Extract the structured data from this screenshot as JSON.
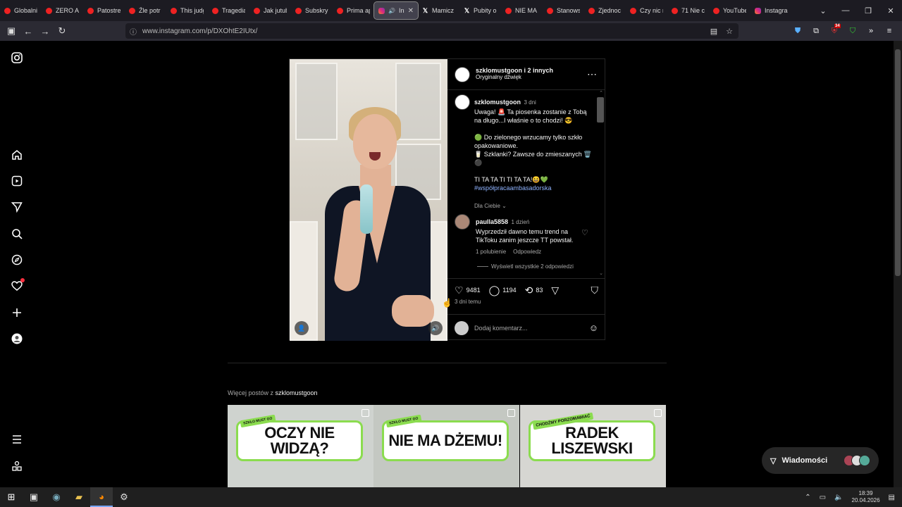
{
  "browser": {
    "tabs": [
      {
        "label": "Globalni",
        "icon": "youtube-icon"
      },
      {
        "label": "ZERO A",
        "icon": "youtube-icon"
      },
      {
        "label": "Patostre",
        "icon": "youtube-icon"
      },
      {
        "label": "Źle potr",
        "icon": "youtube-icon"
      },
      {
        "label": "This judg",
        "icon": "youtube-icon"
      },
      {
        "label": "Tragedia",
        "icon": "youtube-icon"
      },
      {
        "label": "Jak jutub",
        "icon": "youtube-icon"
      },
      {
        "label": "Subskryp",
        "icon": "youtube-icon"
      },
      {
        "label": "Prima ap",
        "icon": "youtube-icon"
      },
      {
        "label": "Inst",
        "icon": "instagram-icon",
        "active": true
      },
      {
        "label": "Mamicz",
        "icon": "x-icon"
      },
      {
        "label": "Pubity o",
        "icon": "x-icon"
      },
      {
        "label": "NIE MA",
        "icon": "youtube-icon"
      },
      {
        "label": "Stanows",
        "icon": "youtube-icon"
      },
      {
        "label": "Zjednoc",
        "icon": "youtube-icon"
      },
      {
        "label": "Czy nic n",
        "icon": "youtube-icon"
      },
      {
        "label": "71 Nie c",
        "icon": "youtube-icon"
      },
      {
        "label": "YouTube",
        "icon": "youtube-icon"
      },
      {
        "label": "Instagra",
        "icon": "instagram-icon"
      }
    ],
    "url": "www.instagram.com/p/DXOhtE2IUtx/",
    "extension_badge": "34"
  },
  "post": {
    "header": {
      "author": "szklomustgoon i 2 innych",
      "subtitle": "Oryginalny dźwięk"
    },
    "caption": {
      "author": "szklomustgoon",
      "time": "3 dni",
      "lines": [
        "Uwaga! 🚨 Ta piosenka zostanie z Tobą na długo...I właśnie o to chodzi! 😎",
        "🟢 Do zielonego wrzucamy tylko szkło opakowaniowe.",
        "🥛 Szklanki? Zawsze do zmieszanych 🗑️⚫",
        "TI TA TA TI TI TA TA!😆💚"
      ],
      "hashtag": "#współpracaambasadorska"
    },
    "filter_label": "Dla Ciebie",
    "comment": {
      "author": "paulla5858",
      "time": "1 dzień",
      "text": "Wyprzedził dawno temu trend na TikToku zanim jeszcze TT powstał.",
      "likes": "1 polubienie",
      "reply": "Odpowiedz",
      "view_replies": "Wyświetl wszystkie 2 odpowiedzi"
    },
    "stats": {
      "likes": "9481",
      "comments": "1194",
      "reposts": "83"
    },
    "posted": "3 dni temu",
    "comment_placeholder": "Dodaj komentarz..."
  },
  "more": {
    "prefix": "Więcej postów z ",
    "author": "szklomustgoon",
    "thumbs": [
      {
        "badge": "SZKŁO MUST GO",
        "title": "OCZY NIE WIDZĄ?"
      },
      {
        "badge": "SZKŁO MUST GO",
        "title": "NIE MA DŻEMU!"
      },
      {
        "badge": "CHODŹMY PORZOMAWIAĆ",
        "title": "RADEK LISZEWSKI"
      }
    ]
  },
  "messages": {
    "label": "Wiadomości"
  },
  "taskbar": {
    "time": "18:39",
    "date": "20.04.2026"
  },
  "colors": {
    "accent_link": "#8fb3ff",
    "notification_dot": "#ff3040",
    "brand_green": "#8bdc4f"
  }
}
